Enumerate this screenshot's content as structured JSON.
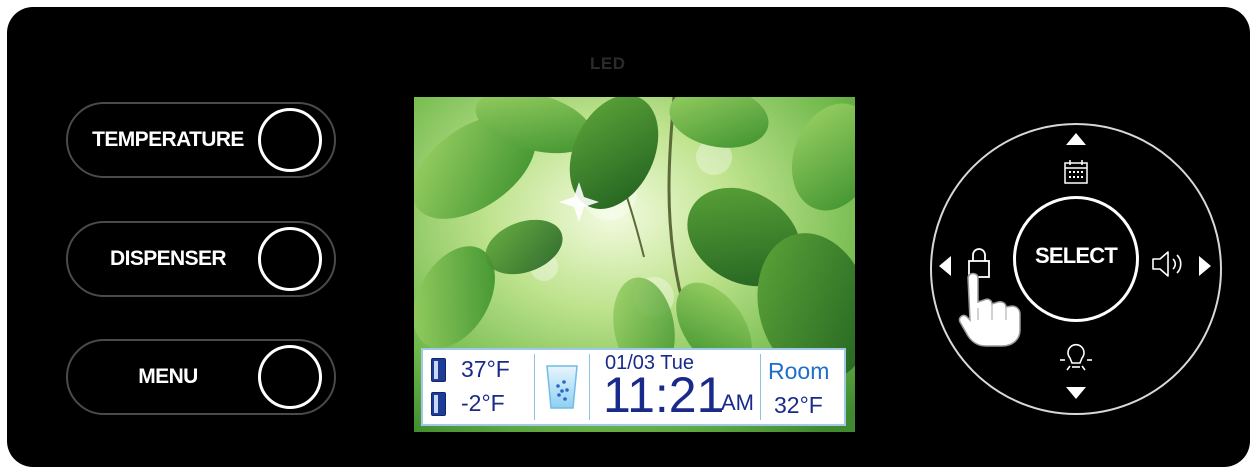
{
  "panel": {
    "led_label": "LED",
    "buttons": [
      {
        "label": "TEMPERATURE"
      },
      {
        "label": "DISPENSER"
      },
      {
        "label": "MENU"
      }
    ]
  },
  "screen": {
    "background": "green-leaves-image",
    "status": {
      "fridge_temp": "37°F",
      "freezer_temp": "-2°F",
      "fridge_icon": "fridge-door-icon",
      "freezer_icon": "freezer-door-icon",
      "dispenser_icon": "water-glass-icon",
      "date": "01/03",
      "day": "Tue",
      "time": "11:21",
      "ampm": "AM",
      "room_label": "Room",
      "room_temp": "32°F"
    }
  },
  "dial": {
    "select_label": "SELECT",
    "icons": [
      "up-arrow-icon",
      "calendar-icon",
      "left-arrow-icon",
      "lock-icon",
      "speaker-icon",
      "right-arrow-icon",
      "light-bulb-icon",
      "down-arrow-icon",
      "pointing-hand-icon"
    ]
  },
  "colors": {
    "panel": "#000000",
    "text_blue": "#1a2a8a",
    "room_blue": "#1e6fc8",
    "status_border": "#9ec9e8"
  }
}
